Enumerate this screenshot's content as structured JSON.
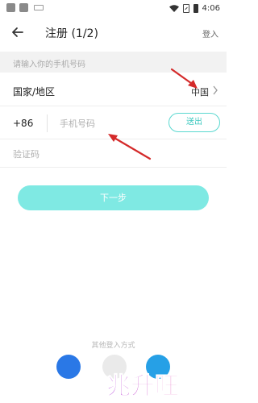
{
  "status_bar": {
    "time": "4:06"
  },
  "header": {
    "title": "注册 (1/2)",
    "login_label": "登入"
  },
  "form": {
    "hint": "请输入你的手机号码",
    "country_label": "国家/地区",
    "country_value": "中国",
    "country_code": "+86",
    "phone_placeholder": "手机号码",
    "send_label": "送出",
    "code_placeholder": "验证码",
    "next_label": "下一步"
  },
  "other_login": {
    "label": "其他登入方式"
  },
  "watermark": {
    "text": "兆升旺"
  },
  "icons": [
    "back-arrow-icon",
    "chevron-right-icon",
    "wifi-icon",
    "battery-icon"
  ],
  "colors": {
    "accent": "#5ad8d0",
    "next_button": "#7fe9e3",
    "annotation_arrow": "#d42a2a"
  }
}
